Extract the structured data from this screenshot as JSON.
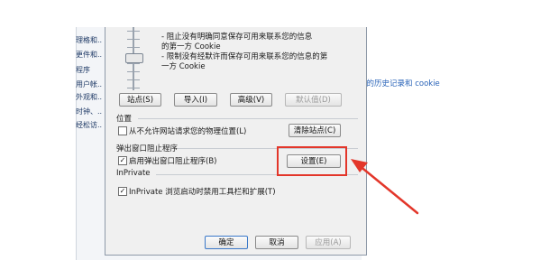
{
  "background_page": {
    "sidebar_items": [
      "理格和...",
      "更件和...",
      "程序",
      "用户帐...",
      "外观和...",
      "时钟、...",
      "经松访..."
    ],
    "history_link": "您的历史记录和 cookie"
  },
  "dialog": {
    "privacy_description": [
      "- 阻止没有明确同意保存可用来联系您的信息",
      "  的第一方 Cookie",
      "- 限制没有经默许而保存可用来联系您的信息的第",
      "  一方 Cookie"
    ],
    "buttons": {
      "sites": "站点(S)",
      "import": "导入(I)",
      "advanced": "高级(V)",
      "default": "默认值(D)"
    },
    "location": {
      "group_label": "位置",
      "never_allow_label": "从不允许网站请求您的物理位置(L)",
      "never_allow_checked": false,
      "clear_sites_button": "清除站点(C)"
    },
    "popup_blocker": {
      "group_label": "弹出窗口阻止程序",
      "enable_label": "启用弹出窗口阻止程序(B)",
      "enable_checked": true,
      "settings_button": "设置(E)"
    },
    "inprivate": {
      "group_label": "InPrivate",
      "disable_toolbars_label": "InPrivate 浏览启动时禁用工具栏和扩展(T)",
      "disable_toolbars_checked": true
    },
    "footer": {
      "ok": "确定",
      "cancel": "取消",
      "apply": "应用(A)"
    }
  },
  "annotation": {
    "highlight_color": "#e3362a",
    "arrow_color": "#e3362a"
  }
}
